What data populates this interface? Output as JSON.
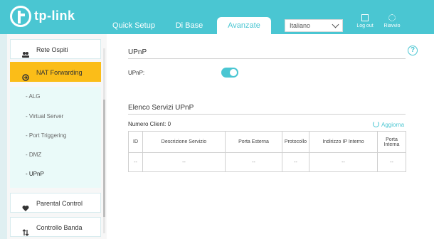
{
  "brand": "tp-link",
  "nav": {
    "tabs": [
      {
        "label": "Quick Setup"
      },
      {
        "label": "Di Base"
      },
      {
        "label": "Avanzate"
      }
    ],
    "language": "Italiano",
    "logout_label": "Log out",
    "reboot_label": "Riavvio"
  },
  "sidebar": {
    "items": [
      {
        "label": "Rete Ospiti",
        "icon": "guests-icon"
      },
      {
        "label": "NAT Forwarding",
        "icon": "nat-icon"
      },
      {
        "label": "Parental Control",
        "icon": "heart-icon"
      },
      {
        "label": "Controllo Banda",
        "icon": "bandwidth-icon"
      }
    ],
    "subitems": [
      "- ALG",
      "- Virtual Server",
      "- Port Triggering",
      "- DMZ",
      "- UPnP"
    ]
  },
  "upnp": {
    "title": "UPnP",
    "field_label": "UPnP:",
    "enabled": true
  },
  "services": {
    "title": "Elenco Servizi UPnP",
    "client_count_label": "Numero Client: 0",
    "refresh_label": "Aggiorna",
    "columns": [
      "ID",
      "Descrizione Servizio",
      "Porta Esterna",
      "Protocollo",
      "Indirizzo IP Interno",
      "Porta Interna"
    ],
    "rows": [
      [
        "--",
        "--",
        "--",
        "--",
        "--",
        "--"
      ]
    ]
  },
  "help_label": "?",
  "colors": {
    "header": "#4ac6d2",
    "active_item": "#fbbd18",
    "accent": "#4ac6d2"
  }
}
